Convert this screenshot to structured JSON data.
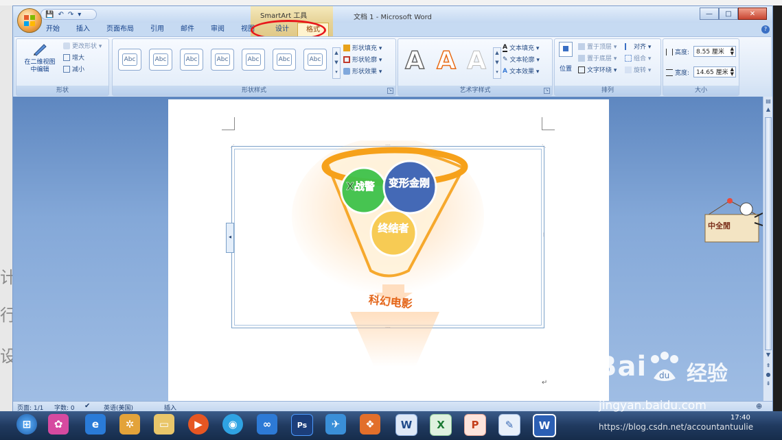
{
  "window": {
    "title": "文档 1 - Microsoft Word",
    "context_title": "SmartArt 工具",
    "controls": [
      "—",
      "□",
      "✕"
    ]
  },
  "quick_access": [
    "💾",
    "↶",
    "↷",
    "▾"
  ],
  "tabs": [
    "开始",
    "插入",
    "页面布局",
    "引用",
    "邮件",
    "审阅",
    "视图",
    "设计",
    "格式"
  ],
  "active_tab": "格式",
  "ribbon": {
    "shapes": {
      "label": "形状",
      "edit_in_2d": "在二维视图中编辑",
      "change_shape": "更改形状 ▾",
      "larger": "增大",
      "smaller": "减小"
    },
    "shape_styles": {
      "label": "形状样式",
      "styles": [
        "Abc",
        "Abc",
        "Abc",
        "Abc",
        "Abc",
        "Abc",
        "Abc"
      ],
      "fill": "形状填充 ▾",
      "outline": "形状轮廓 ▾",
      "effects": "形状效果 ▾"
    },
    "wordart": {
      "label": "艺术字样式",
      "styles": [
        "A",
        "A",
        "A"
      ],
      "text_fill": "文本填充 ▾",
      "text_outline": "文本轮廓 ▾",
      "text_effects": "文本效果 ▾"
    },
    "arrange": {
      "label": "排列",
      "position": "位置",
      "bring_front": "置于顶层 ▾",
      "send_back": "置于底层 ▾",
      "wrap": "文字环绕 ▾",
      "align": "对齐 ▾",
      "group": "组合 ▾",
      "rotate": "旋转 ▾"
    },
    "size": {
      "label": "大小",
      "height_label": "高度:",
      "height_value": "8.55 厘米",
      "width_label": "宽度:",
      "width_value": "14.65 厘米"
    }
  },
  "smartart": {
    "circles": [
      "X战警",
      "变形金刚",
      "终结者"
    ],
    "result": "科幻电影"
  },
  "sticker": "中全閒",
  "statusbar": {
    "page": "页面: 1/1",
    "words": "字数: 0",
    "language": "英语(美国)",
    "mode": "插入"
  },
  "taskbar": {
    "time": "17:40",
    "icons": [
      "ie-icon",
      "paint-icon",
      "folder-icon",
      "media-icon",
      "qq-music-icon",
      "sync-icon",
      "photoshop-icon",
      "bird-icon",
      "gift-icon",
      "word-doc-icon",
      "excel-icon",
      "powerpoint-icon",
      "draw-icon",
      "word-icon"
    ]
  },
  "watermarks": {
    "baidu": "Bai",
    "baidu_cn": "经验",
    "jingyan": "jingyan.baidu.com",
    "csdn": "https://blog.csdn.net/accountantuulie"
  },
  "colors": {
    "funnel_orange": "#f6a11a",
    "circle_green": "#3ec24a",
    "circle_blue": "#3a62b5",
    "circle_yellow": "#f7c94d",
    "highlight_red": "#e8161b"
  }
}
